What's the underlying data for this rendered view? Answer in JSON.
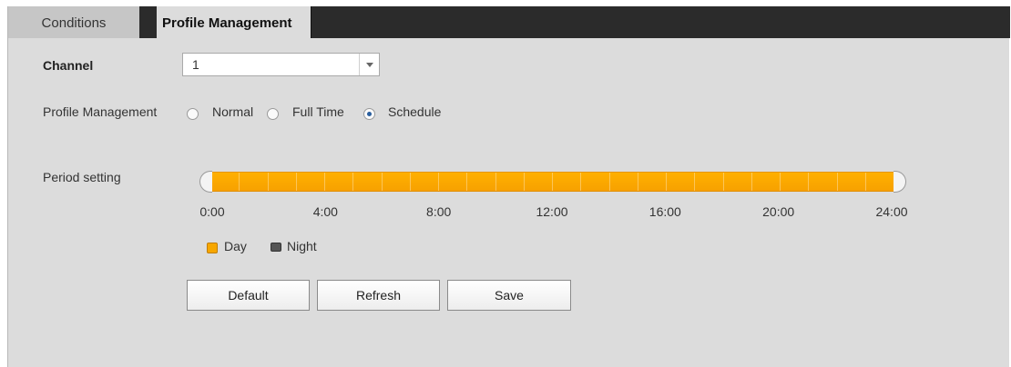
{
  "tabs": [
    {
      "label": "Conditions",
      "active": false
    },
    {
      "label": "Profile Management",
      "active": true
    }
  ],
  "channel": {
    "label": "Channel",
    "value": "1"
  },
  "profile_management": {
    "label": "Profile Management",
    "options": [
      {
        "label": "Normal",
        "checked": false
      },
      {
        "label": "Full Time",
        "checked": false
      },
      {
        "label": "Schedule",
        "checked": true
      }
    ]
  },
  "period_setting": {
    "label": "Period setting",
    "start_time": "0:00",
    "end_time": "24:00",
    "ticks": [
      "0:00",
      "4:00",
      "8:00",
      "12:00",
      "16:00",
      "20:00",
      "24:00"
    ]
  },
  "legend": {
    "day_label": "Day",
    "night_label": "Night",
    "day_color": "#f7a700",
    "night_color": "#555555"
  },
  "buttons": {
    "default_label": "Default",
    "refresh_label": "Refresh",
    "save_label": "Save"
  },
  "icons": {
    "select_arrow": "chevron-down-icon"
  }
}
